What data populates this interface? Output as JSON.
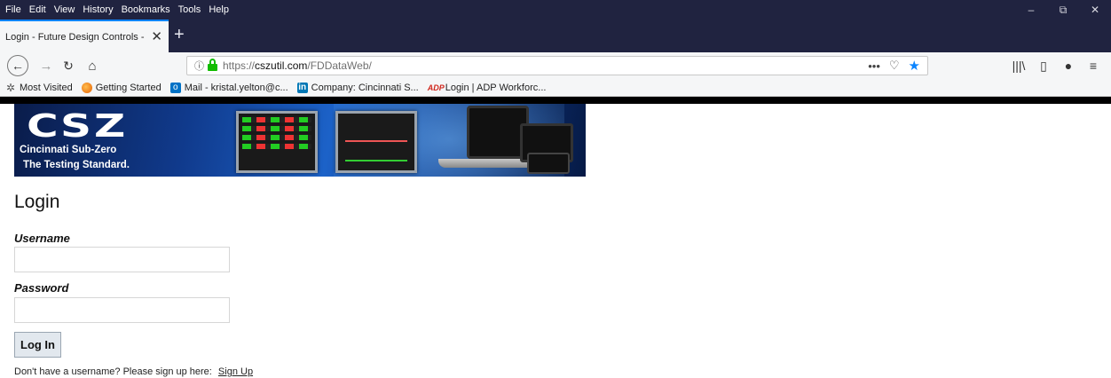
{
  "browser": {
    "menu": [
      "File",
      "Edit",
      "View",
      "History",
      "Bookmarks",
      "Tools",
      "Help"
    ],
    "window_controls": {
      "minimize": "–",
      "restore": "⧉",
      "close": "✕"
    },
    "tab": {
      "title": "Login - Future Design Controls - FD",
      "close": "✕"
    },
    "new_tab": "+",
    "nav": {
      "back": "←",
      "forward": "→",
      "reload": "↻",
      "home": "⌂"
    },
    "url": {
      "scheme": "https://",
      "host": "cszutil.com",
      "path": "/FDDataWeb/"
    },
    "url_actions": {
      "more": "•••",
      "pocket": "♡",
      "star": "★"
    },
    "toolbar_icons": {
      "library": "|||\\",
      "sidebar": "▯",
      "account": "●",
      "menu": "≡"
    },
    "bookmarks": [
      {
        "icon": "gear-icon",
        "label": "Most Visited"
      },
      {
        "icon": "firefox-icon",
        "label": "Getting Started"
      },
      {
        "icon": "outlook-icon",
        "label": "Mail - kristal.yelton@c..."
      },
      {
        "icon": "linkedin-icon",
        "label": "Company: Cincinnati S..."
      },
      {
        "icon": "adp-icon",
        "label": "Login | ADP Workforc..."
      }
    ]
  },
  "banner": {
    "logo_letters": [
      "C",
      "S",
      "Z"
    ],
    "company_name": "Cincinnati Sub-Zero",
    "tagline": "The Testing Standard."
  },
  "page": {
    "title": "Login",
    "username_label": "Username",
    "username_value": "",
    "password_label": "Password",
    "password_value": "",
    "login_button": "Log In",
    "signup_text": "Don't have a username? Please sign up here:",
    "signup_link": "Sign Up"
  }
}
